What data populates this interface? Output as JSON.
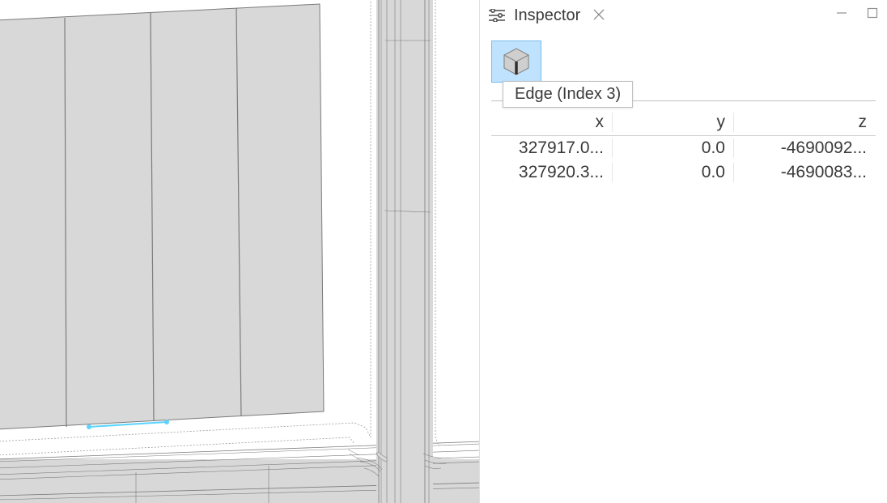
{
  "panel": {
    "title": "Inspector",
    "tooltip": "Edge (Index 3)"
  },
  "table": {
    "headers": {
      "x": "x",
      "y": "y",
      "z": "z"
    },
    "rows": [
      {
        "x": "327917.0...",
        "y": "0.0",
        "z": "-4690092..."
      },
      {
        "x": "327920.3...",
        "y": "0.0",
        "z": "-4690083..."
      }
    ]
  }
}
